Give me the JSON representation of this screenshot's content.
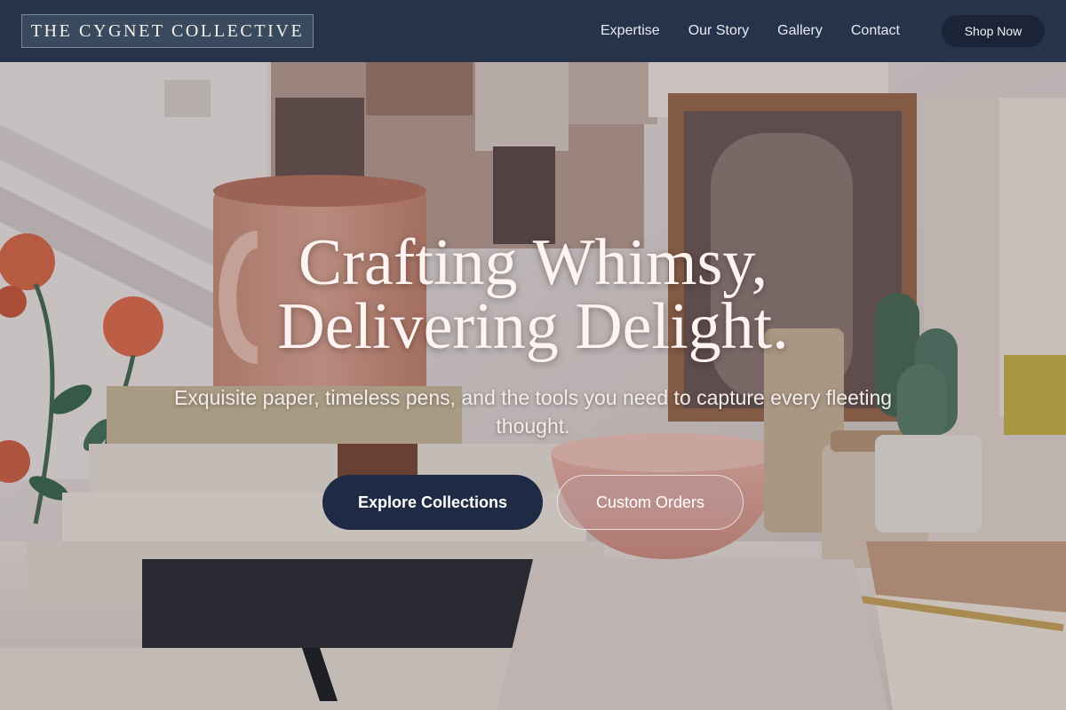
{
  "brand": {
    "logo_text": "THE CYGNET COLLECTIVE"
  },
  "nav": {
    "items": [
      {
        "label": "Expertise"
      },
      {
        "label": "Our Story"
      },
      {
        "label": "Gallery"
      },
      {
        "label": "Contact"
      }
    ],
    "shop_label": "Shop Now"
  },
  "hero": {
    "title_line_1": "Crafting Whimsy,",
    "title_line_2": "Delivering Delight.",
    "subtitle": "Exquisite paper, timeless pens, and the tools you need to capture every fleeting thought.",
    "primary_cta": "Explore Collections",
    "secondary_cta": "Custom Orders",
    "background_image_description_icon": "stationery-desk-photo"
  },
  "colors": {
    "nav_background": "#26334a",
    "primary_button": "#1f2a44",
    "hero_text": "#fff4f2"
  }
}
